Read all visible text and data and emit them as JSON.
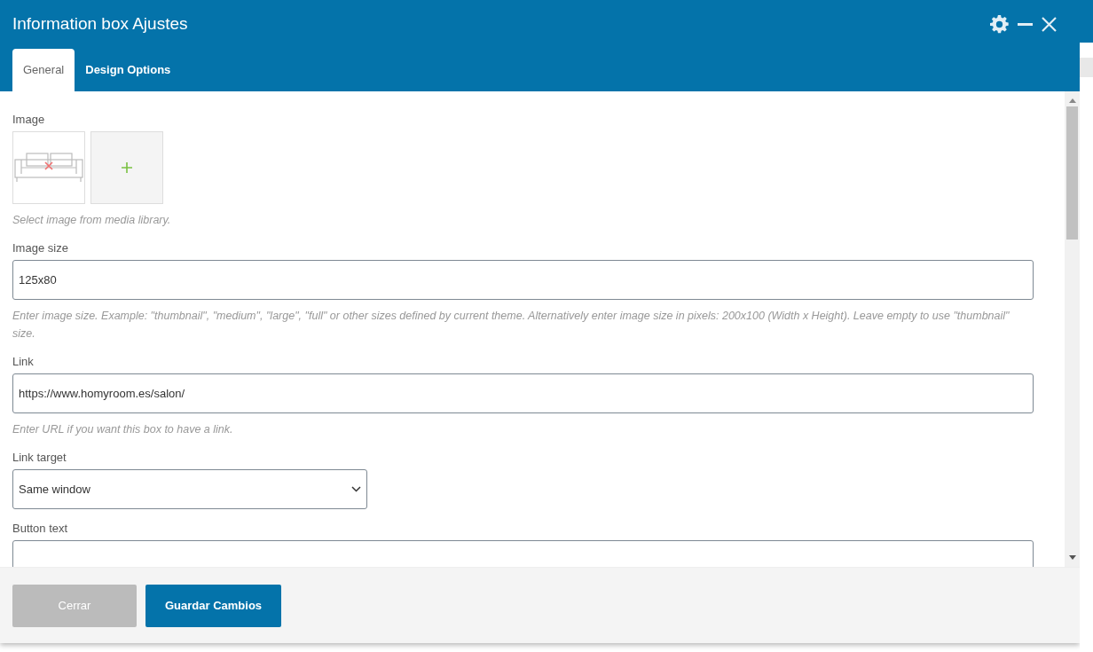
{
  "window": {
    "title": "Information box Ajustes"
  },
  "tabs": [
    {
      "label": "General",
      "selected": true
    },
    {
      "label": "Design Options",
      "selected": false
    }
  ],
  "fields": [
    {
      "kind": "image",
      "label": "Image",
      "help": "Select image from media library."
    },
    {
      "kind": "text",
      "label": "Image size",
      "value": "125x80",
      "help": "Enter image size. Example: \"thumbnail\", \"medium\", \"large\", \"full\" or other sizes defined by current theme. Alternatively enter image size in pixels: 200x100 (Width x Height). Leave empty to use \"thumbnail\" size."
    },
    {
      "kind": "text",
      "label": "Link",
      "value": "https://www.homyroom.es/salon/",
      "help": "Enter URL if you want this box to have a link."
    },
    {
      "kind": "select",
      "label": "Link target",
      "value": "Same window"
    },
    {
      "kind": "text",
      "label": "Button text"
    }
  ],
  "buttons": [
    {
      "label": "Cerrar",
      "kind": "secondary"
    },
    {
      "label": "Guardar Cambios",
      "kind": "primary"
    }
  ]
}
